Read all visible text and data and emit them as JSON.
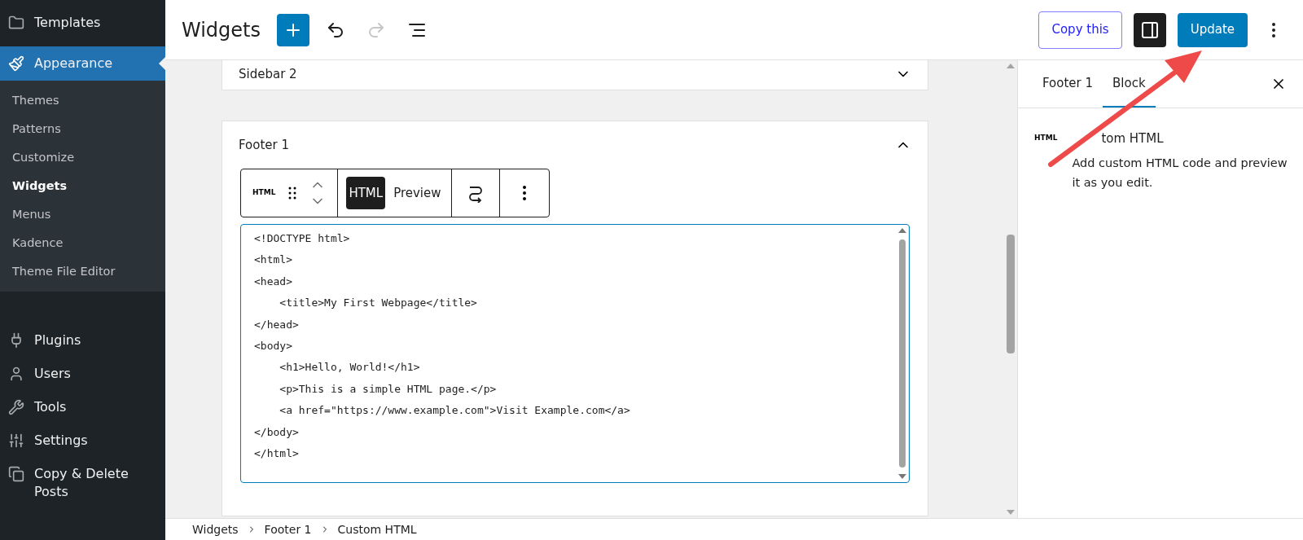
{
  "admin_menu": {
    "top_items": [
      {
        "label": "Templates",
        "selected": false
      }
    ],
    "current": {
      "label": "Appearance",
      "selected": true
    },
    "submenu": [
      {
        "label": "Themes",
        "selected": false
      },
      {
        "label": "Patterns",
        "selected": false
      },
      {
        "label": "Customize",
        "selected": false
      },
      {
        "label": "Widgets",
        "selected": true
      },
      {
        "label": "Menus",
        "selected": false
      },
      {
        "label": "Kadence",
        "selected": false
      },
      {
        "label": "Theme File Editor",
        "selected": false
      }
    ],
    "bottom_items": [
      {
        "label": "Plugins",
        "selected": false
      },
      {
        "label": "Users",
        "selected": false
      },
      {
        "label": "Tools",
        "selected": false
      },
      {
        "label": "Settings",
        "selected": false
      },
      {
        "label": "Copy & Delete Posts",
        "selected": false
      }
    ]
  },
  "header": {
    "title": "Widgets",
    "tools": [
      {
        "kind": "add",
        "disabled": false
      },
      {
        "kind": "undo",
        "disabled": false
      },
      {
        "kind": "redo",
        "disabled": true
      },
      {
        "kind": "list",
        "disabled": false
      }
    ],
    "copy_button": "Copy this",
    "sidebar_toggle": {
      "on": true
    },
    "update_button": "Update"
  },
  "areas": [
    {
      "title": "Sidebar 2",
      "expanded": false
    },
    {
      "title": "Footer 1",
      "expanded": true
    }
  ],
  "block_toolbar": {
    "block_icon": "HTML",
    "modes": [
      {
        "label": "HTML",
        "selected": true
      },
      {
        "label": "Preview",
        "selected": false
      }
    ]
  },
  "code_lines": [
    "<!DOCTYPE html>",
    "<html>",
    "<head>",
    "    <title>My First Webpage</title>",
    "</head>",
    "<body>",
    "    <h1>Hello, World!</h1>",
    "    <p>This is a simple HTML page.</p>",
    "    <a href=\"https://www.example.com\">Visit Example.com</a>",
    "</body>",
    "</html>"
  ],
  "inspector": {
    "tabs": [
      {
        "label": "Footer 1",
        "selected": false
      },
      {
        "label": "Block",
        "selected": true
      }
    ],
    "block_icon": "HTML",
    "block_title": "tom HTML",
    "block_description": "Add custom HTML code and preview it as you edit."
  },
  "breadcrumb": [
    "Widgets",
    "Footer 1",
    "Custom HTML"
  ]
}
